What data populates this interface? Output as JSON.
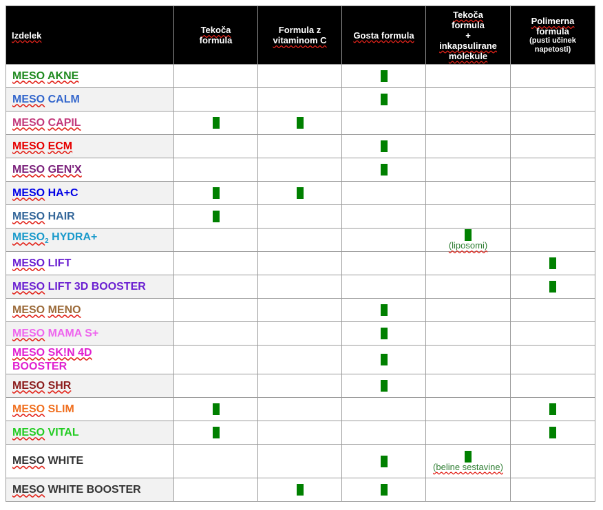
{
  "headers": [
    "Izdelek",
    "Tekoča formula",
    "Formula z vitaminom C",
    "Gosta formula",
    "Tekoča formula + inkapsulirane molekule",
    "Polimerna formula"
  ],
  "header_note": "(pusti učinek napetosti)",
  "header_parts": {
    "c1": [
      "Tekoča",
      "formula"
    ],
    "c2": [
      "Formula z",
      "vitaminom C"
    ],
    "c3": [
      "Gosta formula"
    ],
    "c4": [
      "Tekoča",
      "formula",
      "+",
      "inkapsulirane",
      "molekule"
    ],
    "c5": [
      "Polimerna",
      "formula"
    ]
  },
  "colors": {
    "mark": "#008000",
    "header_bg": "#000000",
    "spell_underline": "#e2231a"
  },
  "rows": [
    {
      "prefix": "MESO",
      "suffix": "AKNE",
      "color": "#1f8a1f",
      "cols": [
        false,
        false,
        true,
        false,
        false
      ]
    },
    {
      "prefix": "MESO",
      "suffix": "CALM",
      "color": "#3366cc",
      "cols": [
        false,
        false,
        true,
        false,
        false
      ]
    },
    {
      "prefix": "MESO",
      "suffix": "CAPIL",
      "color": "#c2397b",
      "cols": [
        true,
        true,
        false,
        false,
        false
      ]
    },
    {
      "prefix": "MESO",
      "suffix": "ECM",
      "color": "#e60000",
      "cols": [
        false,
        false,
        true,
        false,
        false
      ]
    },
    {
      "prefix": "MESO",
      "suffix": "GEN'X",
      "color": "#7a1f7a",
      "cols": [
        false,
        false,
        true,
        false,
        false
      ]
    },
    {
      "prefix": "MESO",
      "suffix": "HA+C",
      "color": "#0000e6",
      "cols": [
        true,
        true,
        false,
        false,
        false
      ]
    },
    {
      "prefix": "MESO",
      "suffix": "HAIR",
      "color": "#336699",
      "cols": [
        true,
        false,
        false,
        false,
        false
      ]
    },
    {
      "prefix": "MESO",
      "sub": "2",
      "suffix": "HYDRA+",
      "color": "#1a9acb",
      "cols": [
        false,
        false,
        false,
        true,
        false
      ],
      "note4": "(liposomi)"
    },
    {
      "prefix": "MESO",
      "suffix": "LIFT",
      "color": "#6a1fd1",
      "cols": [
        false,
        false,
        false,
        false,
        true
      ]
    },
    {
      "prefix": "MESO",
      "suffix": "LIFT 3D BOOSTER",
      "color": "#6a1fd1",
      "cols": [
        false,
        false,
        false,
        false,
        true
      ]
    },
    {
      "prefix": "MESO",
      "suffix": "MENO",
      "color": "#9c6b3a",
      "cols": [
        false,
        false,
        true,
        false,
        false
      ]
    },
    {
      "prefix": "MESO",
      "suffix": "MAMA S+",
      "color": "#ee66ee",
      "cols": [
        false,
        false,
        true,
        false,
        false
      ]
    },
    {
      "prefix": "MESO",
      "suffix": "SK!N 4D",
      "line2": "BOOSTER",
      "color": "#e020d0",
      "cols": [
        false,
        false,
        true,
        false,
        false
      ]
    },
    {
      "prefix": "MESO",
      "suffix": "SHR",
      "color": "#8b1a1a",
      "cols": [
        false,
        false,
        true,
        false,
        false
      ]
    },
    {
      "prefix": "MESO",
      "suffix": "SLIM",
      "color": "#f07020",
      "cols": [
        true,
        false,
        false,
        false,
        true
      ]
    },
    {
      "prefix": "MESO",
      "suffix": "VITAL",
      "color": "#22cc22",
      "cols": [
        true,
        false,
        false,
        false,
        true
      ]
    },
    {
      "prefix": "MESO",
      "suffix": "WHITE",
      "color": "#333333",
      "cols": [
        false,
        false,
        true,
        true,
        false
      ],
      "note4": "(beline sestavine)"
    },
    {
      "prefix": "MESO",
      "suffix": "WHITE BOOSTER",
      "color": "#333333",
      "cols": [
        false,
        true,
        true,
        false,
        false
      ]
    }
  ]
}
